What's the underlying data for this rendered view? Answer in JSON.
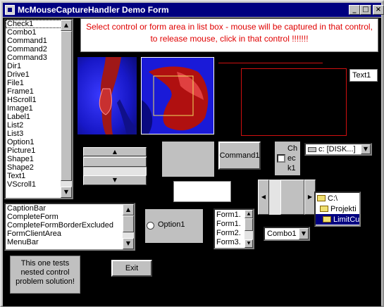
{
  "window": {
    "title": "McMouseCaptureHandler Demo Form",
    "controls": {
      "minimize": "_",
      "maximize": "□",
      "close": "×"
    }
  },
  "message": "Select control or form area in list box - mouse will be captured in that control, to release mouse, click in that control !!!!!!!",
  "controls_list": {
    "items": [
      "Check1",
      "Combo1",
      "Command1",
      "Command2",
      "Command3",
      "Dir1",
      "Drive1",
      "File1",
      "Frame1",
      "HScroll1",
      "Image1",
      "Label1",
      "List2",
      "List3",
      "Option1",
      "Picture1",
      "Shape1",
      "Shape2",
      "Text1",
      "VScroll1"
    ],
    "selected": "Check1"
  },
  "area_list": {
    "items": [
      "CaptionBar",
      "CompleteForm",
      "CompleteFormBorderExcluded",
      "FormClientArea",
      "MenuBar"
    ]
  },
  "text1": {
    "value": "Text1"
  },
  "command1": {
    "label": "Command1"
  },
  "check1": {
    "label": "Check1"
  },
  "drive1": {
    "value": "c: [DISK...]"
  },
  "option1": {
    "label": "Option1"
  },
  "file_list": {
    "items": [
      "Form1.",
      "Form1.",
      "Form2.",
      "Form3."
    ]
  },
  "combo1": {
    "value": "Combo1"
  },
  "dir_list": {
    "items": [
      "C:\\",
      "Projekti",
      "LimitCu"
    ]
  },
  "frame_label": {
    "text": "This one tests nested control problem solution!"
  },
  "exit_button": {
    "label": "Exit"
  },
  "colors": {
    "message": "#e00000",
    "shape": "#d01010",
    "title_bar": "#000080",
    "selection": "#000080"
  }
}
